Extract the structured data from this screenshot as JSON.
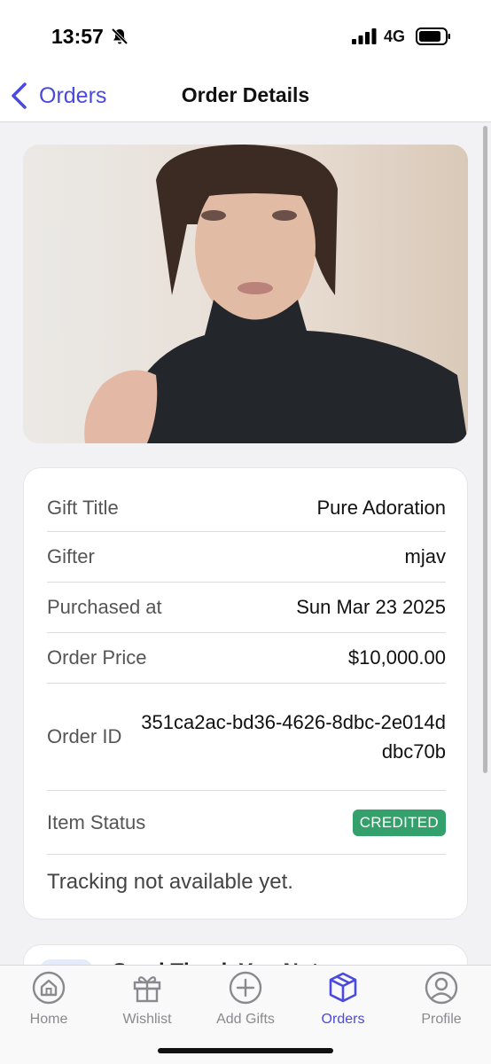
{
  "status_bar": {
    "time": "13:57",
    "network": "4G"
  },
  "nav": {
    "back_label": "Orders",
    "title": "Order Details"
  },
  "details": {
    "gift_title_label": "Gift Title",
    "gift_title_value": "Pure Adoration",
    "gifter_label": "Gifter",
    "gifter_value": "mjav",
    "purchased_label": "Purchased at",
    "purchased_value": "Sun Mar 23 2025",
    "price_label": "Order Price",
    "price_value": "$10,000.00",
    "order_id_label": "Order ID",
    "order_id_value": "351ca2ac-bd36-4626-8dbc-2e014ddbc70b",
    "status_label": "Item Status",
    "status_value": "CREDITED",
    "tracking_text": "Tracking not available yet."
  },
  "next_card": {
    "title": "Send Thank You Note"
  },
  "tabs": [
    {
      "label": "Home",
      "icon": "home-icon",
      "active": false
    },
    {
      "label": "Wishlist",
      "icon": "gift-icon",
      "active": false
    },
    {
      "label": "Add Gifts",
      "icon": "plus-circle-icon",
      "active": false
    },
    {
      "label": "Orders",
      "icon": "box-icon",
      "active": true
    },
    {
      "label": "Profile",
      "icon": "user-circle-icon",
      "active": false
    }
  ],
  "colors": {
    "accent": "#4a4ae0",
    "status_green": "#34a06b",
    "tab_inactive": "#8a8a8e"
  }
}
